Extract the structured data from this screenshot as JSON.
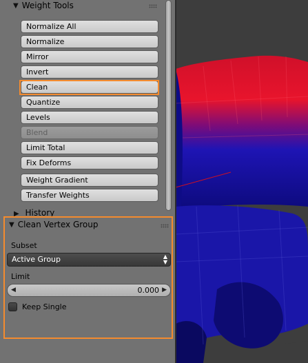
{
  "weight_tools": {
    "title": "Weight Tools",
    "buttons": [
      {
        "label": "Normalize All",
        "disabled": false
      },
      {
        "label": "Normalize",
        "disabled": false
      },
      {
        "label": "Mirror",
        "disabled": false
      },
      {
        "label": "Invert",
        "disabled": false
      },
      {
        "label": "Clean",
        "disabled": false,
        "highlighted": true
      },
      {
        "label": "Quantize",
        "disabled": false
      },
      {
        "label": "Levels",
        "disabled": false
      },
      {
        "label": "Blend",
        "disabled": true
      },
      {
        "label": "Limit Total",
        "disabled": false
      },
      {
        "label": "Fix Deforms",
        "disabled": false
      },
      {
        "label": "Weight Gradient",
        "disabled": false
      },
      {
        "label": "Transfer Weights",
        "disabled": false
      }
    ]
  },
  "history": {
    "title": "History"
  },
  "clean_panel": {
    "title": "Clean Vertex Group",
    "subset_label": "Subset",
    "subset_value": "Active Group",
    "limit_label": "Limit",
    "limit_value": "0.000",
    "keep_single_label": "Keep Single",
    "keep_single_checked": false
  },
  "colors": {
    "highlight": "#f58b2e",
    "panel_bg": "#727272",
    "mesh_red": "#e8102a",
    "mesh_blue": "#1a12a0"
  },
  "icons": [
    "disclosure-triangle-icon",
    "panel-grip-icon",
    "select-arrows-icon",
    "slider-arrow-icon",
    "checkbox-icon"
  ]
}
